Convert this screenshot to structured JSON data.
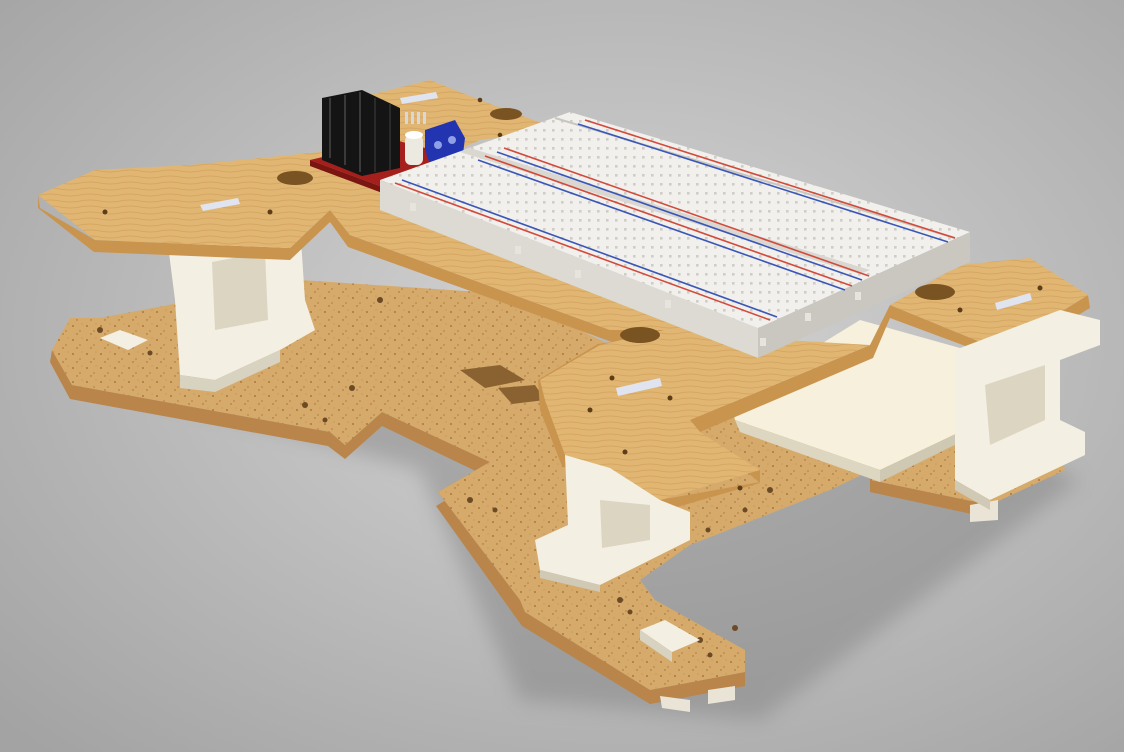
{
  "image": {
    "subject": "render",
    "colors": {
      "background_light": "#d4d4d4",
      "background_dark": "#9a9a9a",
      "plywood_top": "#e0b672",
      "plywood_edge": "#c9944e",
      "particle_board": "#d6aa6a",
      "particle_edge": "#b9854a",
      "plastic_white": "#f3efe3",
      "plastic_shadow": "#d8d2c0",
      "breadboard": "#f1f0ec",
      "rail_red": "#d24a3c",
      "rail_blue": "#3a56b8",
      "heatsink": "#141414",
      "terminal_blue": "#2334b0",
      "pcb_red": "#a5201c"
    }
  }
}
